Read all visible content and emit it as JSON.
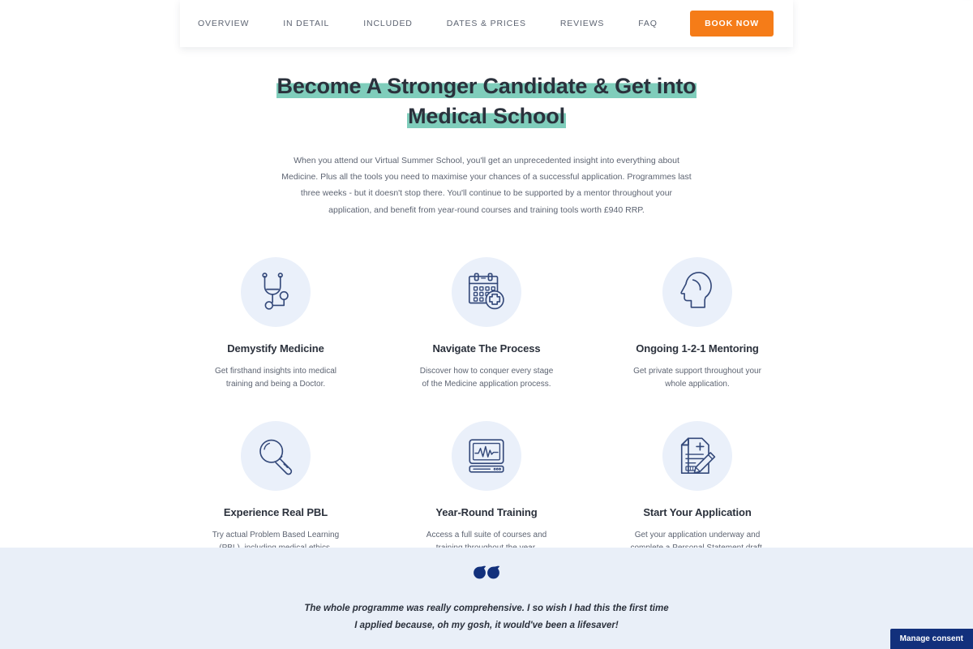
{
  "theme": {
    "accent_orange": "#f57c18",
    "highlight_teal": "#7fcdbb",
    "icon_blue": "#34497a",
    "icon_circle_bg": "#eaf0fa",
    "testimonial_bg": "#e9eff8",
    "consent_blue": "#12307c",
    "heading_color": "#2b313c",
    "body_text_color": "#5d6472",
    "curve_fill": "#e9eff8"
  },
  "navbar": {
    "links": [
      {
        "label": "OVERVIEW"
      },
      {
        "label": "IN DETAIL"
      },
      {
        "label": "INCLUDED"
      },
      {
        "label": "DATES & PRICES"
      },
      {
        "label": "REVIEWS"
      },
      {
        "label": "FAQ"
      }
    ],
    "cta_label": "BOOK NOW"
  },
  "hero": {
    "title_line_1": "Become A Stronger Candidate & Get into",
    "title_line_2": "Medical School",
    "paragraph": "When you attend our Virtual Summer School, you'll get an unprecedented insight into everything about Medicine. Plus all the tools you need to maximise your chances of a successful application. Programmes last three weeks - but it doesn't stop there. You'll continue to be supported by a mentor throughout your application, and benefit from year-round courses and training tools worth £940 RRP."
  },
  "features": [
    {
      "icon": "stethoscope-icon",
      "title": "Demystify Medicine",
      "description": "Get firsthand insights into medical training and being a Doctor."
    },
    {
      "icon": "calendar-medical-icon",
      "title": "Navigate The Process",
      "description": "Discover how to conquer every stage of the Medicine application process."
    },
    {
      "icon": "head-profile-icon",
      "title": "Ongoing 1-2-1 Mentoring",
      "description": "Get private support throughout your whole application."
    },
    {
      "icon": "magnifying-glass-icon",
      "title": "Experience Real PBL",
      "description": "Try actual Problem Based Learning (PBL), including medical ethics."
    },
    {
      "icon": "monitor-ecg-icon",
      "title": "Year-Round Training",
      "description": "Access a full suite of courses and training throughout the year."
    },
    {
      "icon": "document-pencil-icon",
      "title": "Start Your Application",
      "description": "Get your application underway and complete a Personal Statement draft."
    }
  ],
  "testimonial": {
    "quote_icon": "quote-mark-icon",
    "text": "The whole programme was really comprehensive. I so wish I had this the first time I applied because, oh my gosh, it would've been a lifesaver!"
  },
  "consent": {
    "label": "Manage consent"
  }
}
